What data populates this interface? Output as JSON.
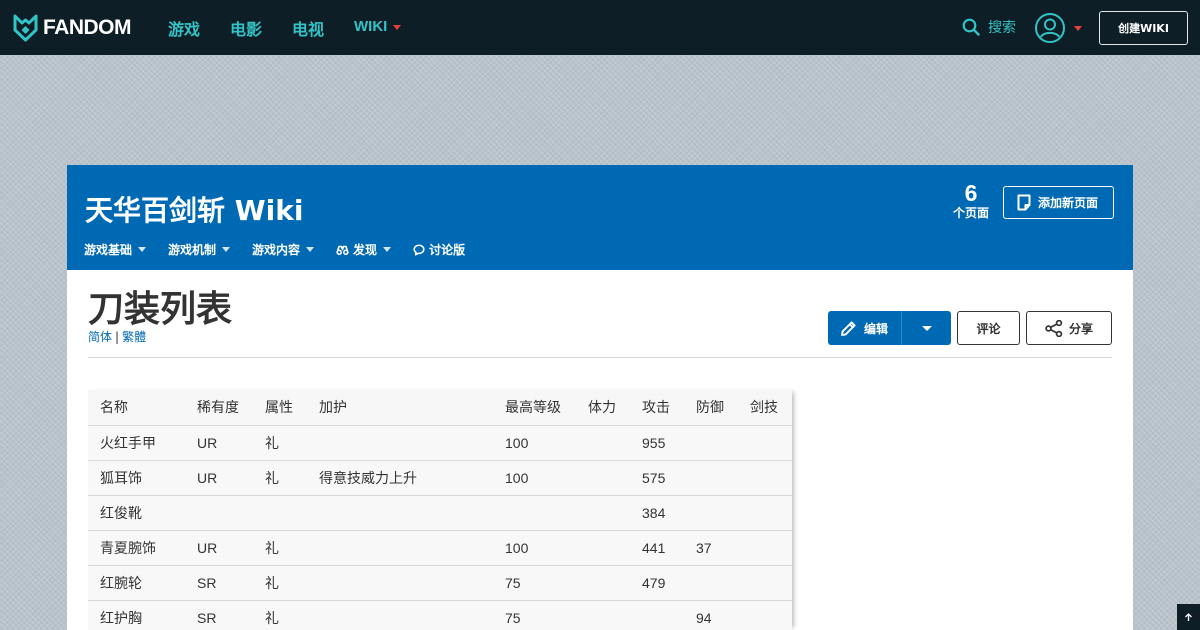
{
  "global_nav": {
    "logo": "FANDOM",
    "links": [
      {
        "label": "游戏"
      },
      {
        "label": "电影"
      },
      {
        "label": "电视"
      },
      {
        "label": "WIKI"
      }
    ],
    "search_label": "搜索",
    "create_wiki": "创建WIKI"
  },
  "community": {
    "title": "天华百剑斩 Wiki",
    "page_count": "6",
    "page_count_label": "个页面",
    "add_page": "添加新页面",
    "nav": [
      {
        "label": "游戏基础"
      },
      {
        "label": "游戏机制"
      },
      {
        "label": "游戏内容"
      },
      {
        "label": "发现"
      },
      {
        "label": "讨论版"
      }
    ]
  },
  "article": {
    "title": "刀装列表",
    "lang_simplified": "简体",
    "lang_separator": "|",
    "lang_traditional": "繁體",
    "actions": {
      "edit": "编辑",
      "comment": "评论",
      "share": "分享"
    }
  },
  "table": {
    "headers": [
      "名称",
      "稀有度",
      "属性",
      "加护",
      "最高等级",
      "体力",
      "攻击",
      "防御",
      "剑技"
    ],
    "rows": [
      [
        "火红手甲",
        "UR",
        "礼",
        "",
        "100",
        "",
        "955",
        "",
        ""
      ],
      [
        "狐耳饰",
        "UR",
        "礼",
        "得意技威力上升",
        "100",
        "",
        "575",
        "",
        ""
      ],
      [
        "红俊靴",
        "",
        "",
        "",
        "",
        "",
        "384",
        "",
        ""
      ],
      [
        "青夏腕饰",
        "UR",
        "礼",
        "",
        "100",
        "",
        "441",
        "37",
        ""
      ],
      [
        "红腕轮",
        "SR",
        "礼",
        "",
        "75",
        "",
        "479",
        "",
        ""
      ],
      [
        "红护胸",
        "SR",
        "礼",
        "",
        "75",
        "",
        "",
        "94",
        ""
      ]
    ]
  },
  "colors": {
    "global_nav_bg": "#0e1e26",
    "accent_teal": "#33c3c6",
    "community_blue": "#0069b4",
    "caret_red": "#e8413a"
  },
  "icons": [
    "fandom-logo-icon",
    "search-icon",
    "user-avatar-icon",
    "add-page-icon",
    "discover-icon",
    "discussions-icon",
    "pencil-icon",
    "share-icon",
    "arrow-up-icon"
  ]
}
